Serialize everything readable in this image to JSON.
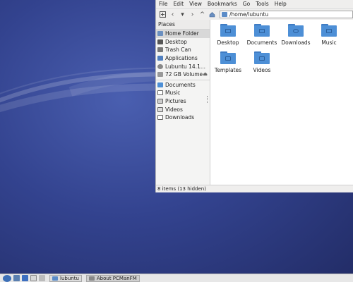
{
  "menubar": [
    "File",
    "Edit",
    "View",
    "Bookmarks",
    "Go",
    "Tools",
    "Help"
  ],
  "toolbar": {
    "path": "/home/lubuntu"
  },
  "places": {
    "title": "Places",
    "items": [
      {
        "label": "Home Folder",
        "icon": "home-icon"
      },
      {
        "label": "Desktop",
        "icon": "desktop-icon"
      },
      {
        "label": "Trash Can",
        "icon": "trash-icon"
      },
      {
        "label": "Applications",
        "icon": "applications-icon"
      },
      {
        "label": "Lubuntu 14.1...",
        "icon": "disc-icon"
      },
      {
        "label": "72 GB Volume",
        "icon": "drive-icon"
      }
    ],
    "bookmarks": [
      {
        "label": "Documents",
        "icon": "folder-icon"
      },
      {
        "label": "Music",
        "icon": "music-icon"
      },
      {
        "label": "Pictures",
        "icon": "pictures-icon"
      },
      {
        "label": "Videos",
        "icon": "videos-icon"
      },
      {
        "label": "Downloads",
        "icon": "downloads-icon"
      }
    ]
  },
  "files": [
    "Desktop",
    "Documents",
    "Downloads",
    "Music",
    "Templates",
    "Videos"
  ],
  "status": "8 items (13 hidden)",
  "taskbar": {
    "tasks": [
      "lubuntu",
      "About PCManFM"
    ]
  },
  "colors": {
    "folder": "#4d8fd6",
    "desktop_bg": "#33438f"
  }
}
